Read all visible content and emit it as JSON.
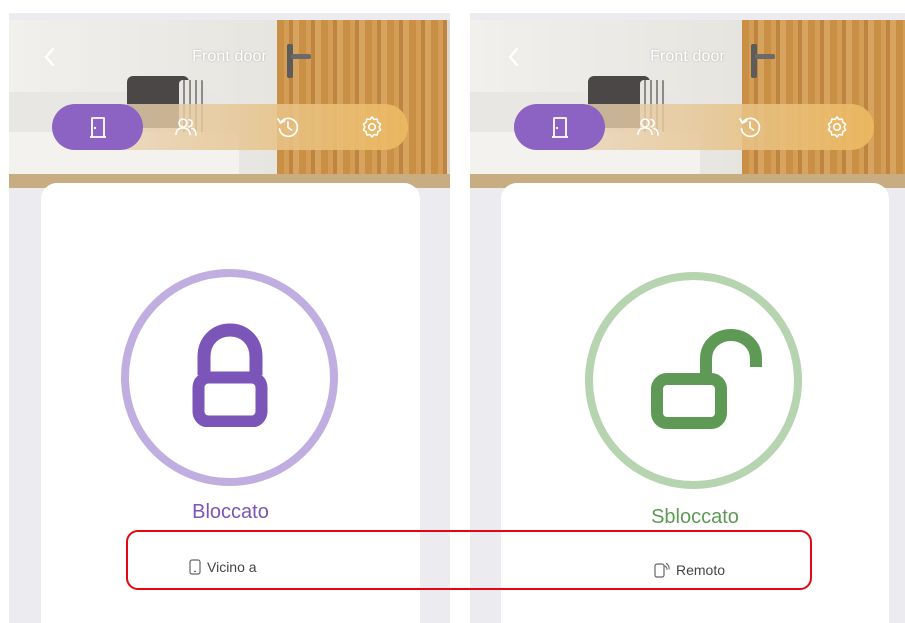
{
  "screens": [
    {
      "id": "left",
      "header": {
        "title": "Front door"
      },
      "tabs": [
        {
          "name": "door",
          "active": true
        },
        {
          "name": "users",
          "active": false
        },
        {
          "name": "history",
          "active": false
        },
        {
          "name": "settings",
          "active": false
        }
      ],
      "lock": {
        "state_label": "Bloccato",
        "state": "locked",
        "color": "#7b55b8",
        "ring_color": "#c0aee0"
      },
      "mode": {
        "label": "Vicino a",
        "icon": "phone-icon"
      }
    },
    {
      "id": "right",
      "header": {
        "title": "Front door"
      },
      "tabs": [
        {
          "name": "door",
          "active": true
        },
        {
          "name": "users",
          "active": false
        },
        {
          "name": "history",
          "active": false
        },
        {
          "name": "settings",
          "active": false
        }
      ],
      "lock": {
        "state_label": "Sbloccato",
        "state": "unlocked",
        "color": "#5e9a55",
        "ring_color": "#b6d4b0"
      },
      "mode": {
        "label": "Remoto",
        "icon": "remote-phone-icon"
      }
    }
  ],
  "annotation": {
    "color": "#e30613"
  }
}
